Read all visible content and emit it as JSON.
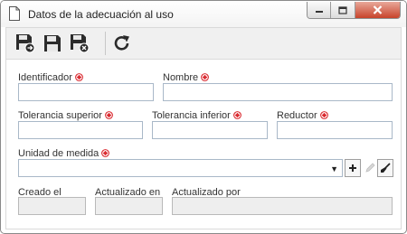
{
  "window": {
    "title": "Datos de la adecuación al uso",
    "minimize_icon": "minimize-icon",
    "maximize_icon": "maximize-icon",
    "close_icon": "close-icon"
  },
  "toolbar": {
    "buttons": [
      "save-and-new-icon",
      "save-icon",
      "save-and-close-icon",
      "refresh-icon"
    ]
  },
  "form": {
    "identificador": {
      "label": "Identificador",
      "value": ""
    },
    "nombre": {
      "label": "Nombre",
      "value": ""
    },
    "tolerancia_superior": {
      "label": "Tolerancia superior",
      "value": ""
    },
    "tolerancia_inferior": {
      "label": "Tolerancia inferior",
      "value": ""
    },
    "reductor": {
      "label": "Reductor",
      "value": ""
    },
    "unidad_medida": {
      "label": "Unidad de medida",
      "value": ""
    },
    "creado_el": {
      "label": "Creado el",
      "value": ""
    },
    "actualizado_en": {
      "label": "Actualizado en",
      "value": ""
    },
    "actualizado_por": {
      "label": "Actualizado por",
      "value": ""
    }
  },
  "colors": {
    "required": "#d9262c",
    "close_button": "#c7432b",
    "input_border": "#a9b8c8"
  }
}
